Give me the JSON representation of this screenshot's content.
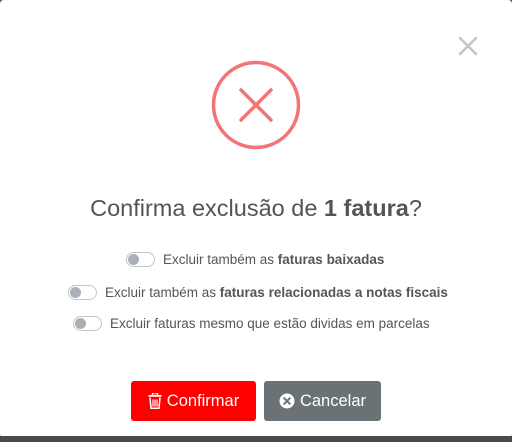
{
  "dialog": {
    "title_prefix": "Confirma exclusão de ",
    "title_bold": "1 fatura",
    "title_suffix": "?",
    "options": [
      {
        "label_prefix": "Excluir também as ",
        "label_bold": "faturas baixadas",
        "checked": false
      },
      {
        "label_prefix": "Excluir também as ",
        "label_bold": "faturas relacionadas a notas fiscais",
        "checked": false
      },
      {
        "label_prefix": "Excluir faturas mesmo que estão dividas em parcelas",
        "label_bold": "",
        "checked": false
      }
    ],
    "confirm_label": "Confirmar",
    "cancel_label": "Cancelar"
  },
  "colors": {
    "error_ring": "#f27474",
    "confirm_bg": "#ff0000",
    "cancel_bg": "#6b7276",
    "close_icon": "#c4c4c4"
  },
  "icons": {
    "close": "close-icon",
    "error": "error-x-icon",
    "confirm": "trash-icon",
    "cancel": "times-circle-icon"
  }
}
